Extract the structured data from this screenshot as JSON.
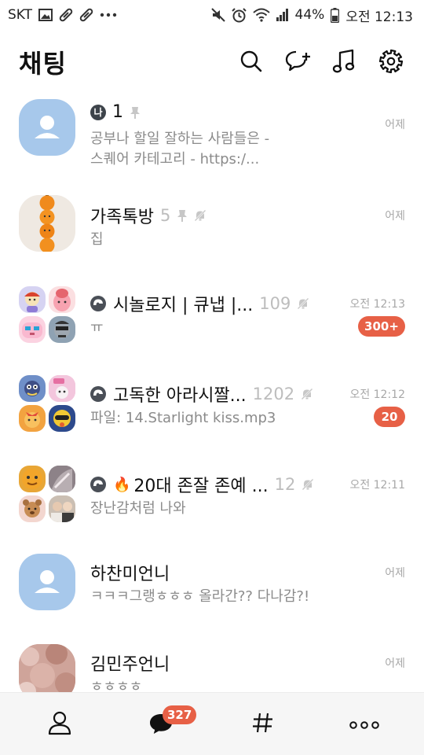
{
  "status_bar": {
    "carrier": "SKT",
    "battery": "44%",
    "time": "오전 12:13",
    "icons": [
      "image-icon",
      "pill-icon",
      "pill-icon",
      "more-icon",
      "mute-icon",
      "alarm-icon",
      "wifi-icon",
      "signal-icon",
      "battery-icon"
    ]
  },
  "header": {
    "title": "채팅",
    "icons": [
      "search-icon",
      "new-chat-icon",
      "music-icon",
      "settings-icon"
    ]
  },
  "chats": [
    {
      "name": "1",
      "me_badge": "나",
      "preview_line1": "공부나 할일 잘하는 사람들은 -",
      "preview_line2": "스퀘어 카테고리 - https:/...",
      "time": "어제",
      "pinned": true
    },
    {
      "name": "가족톡방",
      "count": "5",
      "preview": "집",
      "time": "어제",
      "pinned": true,
      "muted": true
    },
    {
      "name": "시놀로지 | 큐냅 |...",
      "count": "109",
      "preview": "ㅠ",
      "time": "오전 12:13",
      "unread": "300+",
      "open_chat": true,
      "muted": true
    },
    {
      "name": "고독한 아라시짤...",
      "count": "1202",
      "preview": "파일: 14.Starlight kiss.mp3",
      "time": "오전 12:12",
      "unread": "20",
      "open_chat": true,
      "muted": true
    },
    {
      "name": "20대 존잘 존예 ...",
      "fire": "🔥",
      "count": "12",
      "preview": "장난감처럼 나와",
      "time": "오전 12:11",
      "open_chat": true,
      "muted": true
    },
    {
      "name": "하찬미언니",
      "preview": "ㅋㅋㅋ그랭ㅎㅎㅎ 올라간?? 다나감?!",
      "time": "어제"
    },
    {
      "name": "김민주언니",
      "preview": "ㅎㅎㅎㅎ",
      "time": "어제"
    }
  ],
  "bottom_nav": {
    "items": [
      "friends-icon",
      "chats-icon",
      "hashtag-icon",
      "more-icon"
    ],
    "chat_badge": "327"
  },
  "colors": {
    "accent_badge": "#e76046",
    "default_avatar": "#a7c8eb",
    "muted_text": "#8b8b8b"
  }
}
